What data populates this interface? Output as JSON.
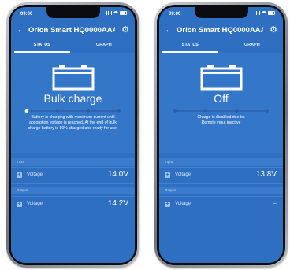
{
  "screens": [
    {
      "status_time": "09:00",
      "title": "Orion Smart HQ0000AAA...",
      "tabs": [
        "STATUS",
        "GRAPH"
      ],
      "state": "Bulk charge",
      "progress_step": 1,
      "description_lines": [
        "Battery is charging with maximum current until",
        "absorption voltage is reached. At the end of bulk",
        "charge battery is 80% charged and ready for use."
      ],
      "input_section": "Input",
      "input_voltage_label": "Voltage",
      "input_voltage_value": "14.0V",
      "output_section": "Output",
      "output_voltage_label": "Voltage",
      "output_voltage_value": "14.2V"
    },
    {
      "status_time": "09:00",
      "title": "Orion Smart HQ0000AAA...",
      "tabs": [
        "STATUS",
        "GRAPH"
      ],
      "state": "Off",
      "progress_step": 0,
      "description_lines": [
        "Charge is disabled due to:",
        "Remote input inactive"
      ],
      "input_section": "Input",
      "input_voltage_label": "Voltage",
      "input_voltage_value": "13.8V",
      "output_section": "Output",
      "output_voltage_label": "Voltage",
      "output_voltage_value": "--"
    }
  ],
  "colors": {
    "primary": "#2f6fc1",
    "hero": "#3476c8",
    "text": "#ffffff"
  },
  "icons": {
    "back": "arrow-left-icon",
    "settings": "gear-icon",
    "battery": "battery-icon",
    "expand": "plus-icon"
  }
}
